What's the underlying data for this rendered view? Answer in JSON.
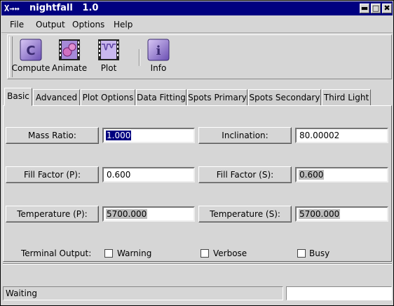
{
  "window": {
    "title": "nightfall   1.0",
    "wm_icon": "X→↔",
    "controls": {
      "minimize": "▬",
      "maximize": "□",
      "close": "✖"
    }
  },
  "menu": [
    "File",
    "Output",
    "Options",
    "Help"
  ],
  "toolbar": {
    "buttons": [
      {
        "label": "Compute",
        "icon": "compute-icon",
        "glyph": "C"
      },
      {
        "label": "Animate",
        "icon": "animate-icon"
      },
      {
        "label": "Plot",
        "icon": "plot-icon"
      },
      {
        "label": "Info",
        "icon": "info-icon",
        "glyph": "i"
      }
    ]
  },
  "tabs": [
    "Basic",
    "Advanced",
    "Plot Options",
    "Data Fitting",
    "Spots Primary",
    "Spots Secondary",
    "Third Light"
  ],
  "active_tab": "Basic",
  "fields": {
    "mass_ratio": {
      "label": "Mass Ratio:",
      "value": "1.000"
    },
    "inclination": {
      "label": "Inclination:",
      "value": "80.00002"
    },
    "fill_factor_p": {
      "label": "Fill Factor (P):",
      "value": "0.600"
    },
    "fill_factor_s": {
      "label": "Fill Factor (S):",
      "value": "0.600"
    },
    "temperature_p": {
      "label": "Temperature (P):",
      "value": "5700.000"
    },
    "temperature_s": {
      "label": "Temperature (S):",
      "value": "5700.000"
    }
  },
  "terminal_output": {
    "label": "Terminal Output:",
    "options": [
      {
        "label": "Warning",
        "checked": false
      },
      {
        "label": "Verbose",
        "checked": false
      },
      {
        "label": "Busy",
        "checked": false
      }
    ]
  },
  "status": {
    "text": "Waiting"
  },
  "colors": {
    "titlebar": "#000080",
    "window_bg": "#d6d6d6",
    "selection": "#000080",
    "icon_purple": "#9a7fd6"
  }
}
